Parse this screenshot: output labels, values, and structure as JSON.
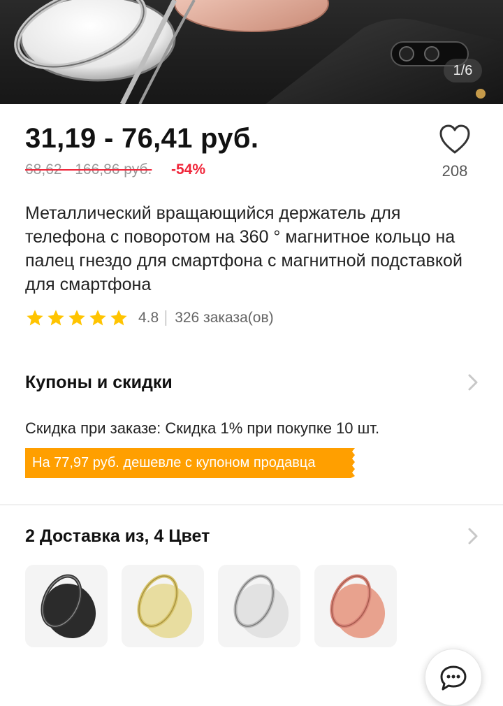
{
  "gallery": {
    "counter": "1/6"
  },
  "price": {
    "current": "31,19 - 76,41 руб.",
    "old": "68,62 - 166,86 руб.",
    "discount": "-54%"
  },
  "favorites": {
    "count": "208"
  },
  "product": {
    "title": "Металлический вращающийся держатель для телефона с поворотом на 360 ° магнитное кольцо на палец гнездо для смартфона с магнитной подставкой для смартфона"
  },
  "rating": {
    "value": "4.8",
    "orders": "326 заказа(ов)",
    "stars": 5
  },
  "coupons": {
    "title": "Купоны и скидки",
    "discount_text": "Скидка при заказе: Скидка 1% при покупке 10 шт.",
    "coupon_banner": "На 77,97 руб. дешевле с купоном продавца"
  },
  "variants": {
    "title": "2 Доставка из, 4 Цвет",
    "colors": [
      "black",
      "gold",
      "silver",
      "rose-gold"
    ]
  },
  "colors": {
    "accent_red": "#f0263a",
    "coupon_orange": "#ff9f00",
    "star_yellow": "#ffc400"
  }
}
